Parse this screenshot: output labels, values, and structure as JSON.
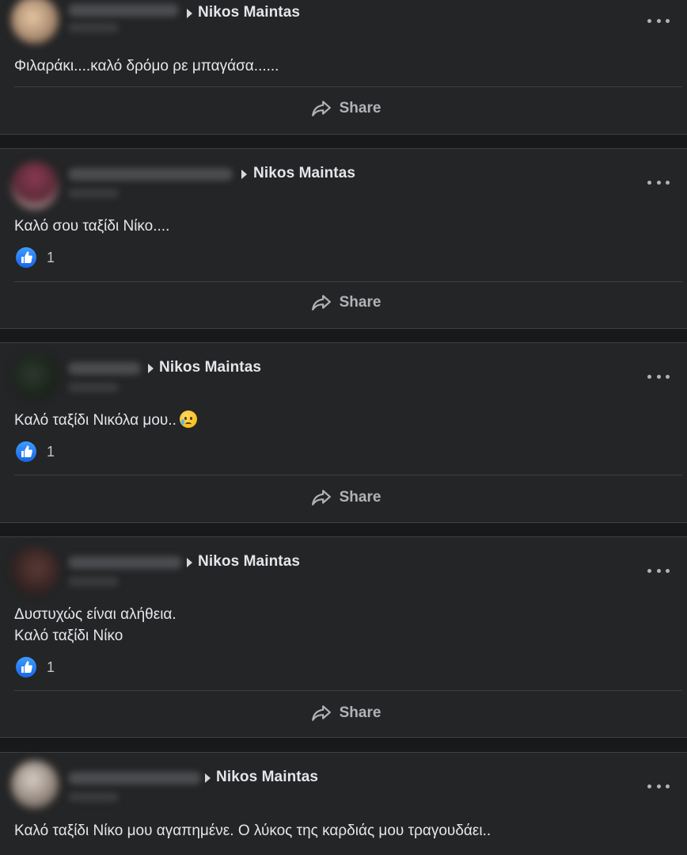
{
  "icons": {
    "arrow": "right-triangle-icon",
    "more": "more-options-icon",
    "like": "like-icon",
    "share": "share-icon",
    "emoji": "sad-tear-emoji-icon"
  },
  "colors": {
    "background": "#18191a",
    "card": "#242526",
    "like_blue": "#1877f2",
    "text": "#e4e6eb",
    "secondary_text": "#b0b3b8"
  },
  "posts": [
    {
      "target": "Nikos Maintas",
      "text_lines": [
        "Φιλαράκι....καλό δρόμο ρε μπαγάσα......"
      ],
      "reactions": null,
      "share_label": "Share"
    },
    {
      "target": "Nikos Maintas",
      "text_lines": [
        "Καλό σου ταξίδι Νίκο...."
      ],
      "reactions": "1",
      "share_label": "Share"
    },
    {
      "target": "Nikos Maintas",
      "text_lines": [
        "Καλό ταξίδι Νικόλα μου.."
      ],
      "reactions": "1",
      "share_label": "Share"
    },
    {
      "target": "Nikos Maintas",
      "text_lines": [
        "Δυστυχώς είναι αλήθεια.",
        "Καλό ταξίδι Νίκο"
      ],
      "reactions": "1",
      "share_label": "Share"
    },
    {
      "target": "Nikos Maintas",
      "text_lines": [
        "Καλό ταξίδι Νίκο μου αγαπημένε. Ο λύκος της καρδιάς μου τραγουδάει.."
      ],
      "reactions": null,
      "share_label": null
    }
  ]
}
